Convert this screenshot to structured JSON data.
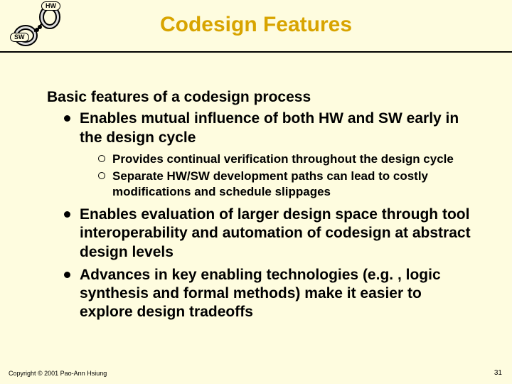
{
  "title": "Codesign Features",
  "logo": {
    "hw_label": "HW",
    "sw_label": "SW"
  },
  "lead": "Basic features of a codesign process",
  "bullets": {
    "b1": "Enables mutual influence of both HW and SW early in the design cycle",
    "b1_sub1": "Provides continual verification throughout the design cycle",
    "b1_sub2": "Separate HW/SW development paths can lead to costly modifications and schedule slippages",
    "b2": "Enables evaluation of larger design space through tool interoperability and automation of codesign at abstract design levels",
    "b3": "Advances in key enabling technologies (e.g. , logic synthesis and formal methods) make it easier to explore design tradeoffs"
  },
  "copyright": "Copyright © 2001 Pao-Ann Hsiung",
  "page_number": "31"
}
